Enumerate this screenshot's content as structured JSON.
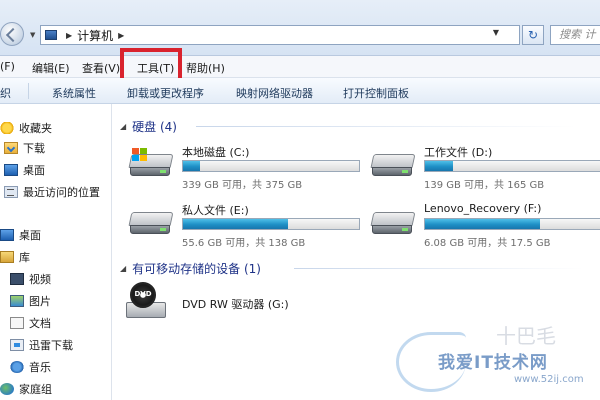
{
  "address": {
    "crumb": "计算机",
    "search_placeholder": "搜索 计"
  },
  "menu": {
    "file": "(F)",
    "edit": "编辑(E)",
    "view": "查看(V)",
    "tools": "工具(T)",
    "help": "帮助(H)"
  },
  "commands": {
    "organize": "织",
    "system_properties": "系统属性",
    "uninstall": "卸载或更改程序",
    "map_drive": "映射网络驱动器",
    "control_panel": "打开控制面板"
  },
  "sidebar": {
    "favorites": "收藏夹",
    "downloads": "下载",
    "desktop": "桌面",
    "recent": "最近访问的位置",
    "desktop2": "桌面",
    "libraries": "库",
    "videos": "视频",
    "pictures": "图片",
    "documents": "文档",
    "xunlei": "迅雷下载",
    "music": "音乐",
    "homegroup": "家庭组"
  },
  "groups": {
    "hard_disks": "硬盘 (4)",
    "removable": "有可移动存储的设备 (1)"
  },
  "drives": [
    {
      "name": "本地磁盘 (C:)",
      "free_text": "339 GB 可用，共 375 GB",
      "used_fraction": 0.096
    },
    {
      "name": "工作文件 (D:)",
      "free_text": "139 GB 可用，共 165 GB",
      "used_fraction": 0.158
    },
    {
      "name": "私人文件 (E:)",
      "free_text": "55.6 GB 可用，共 138 GB",
      "used_fraction": 0.597
    },
    {
      "name": "Lenovo_Recovery (F:)",
      "free_text": "6.08 GB 可用，共 17.5 GB",
      "used_fraction": 0.653
    }
  ],
  "dvd": {
    "icon_label": "DVD",
    "name": "DVD RW 驱动器 (G:)"
  },
  "watermark": {
    "cn": "我爱IT技术网",
    "url": "www.52ij.com",
    "ghost": "十巴毛"
  }
}
